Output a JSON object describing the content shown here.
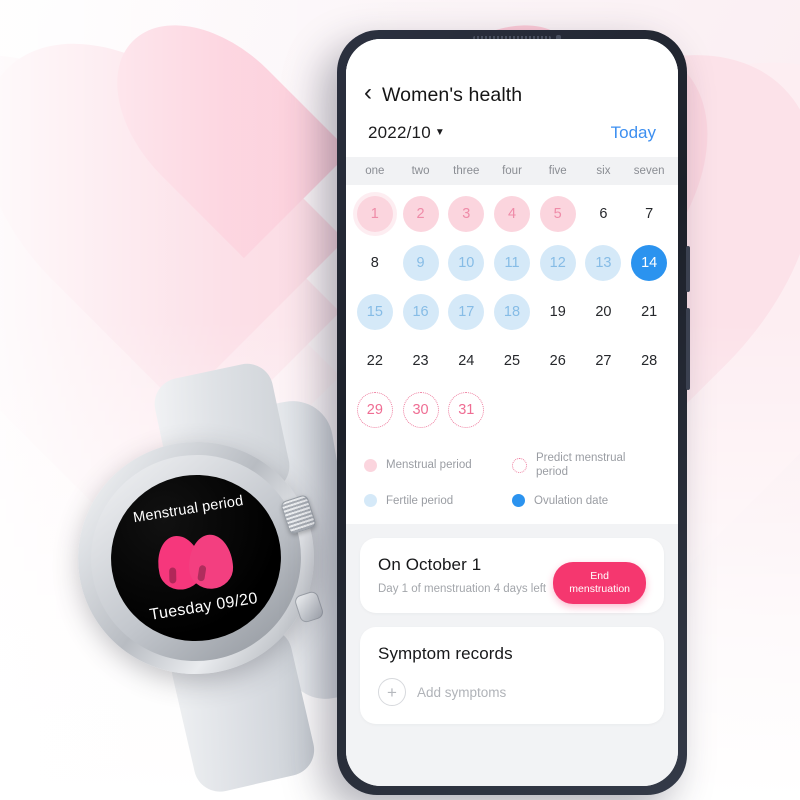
{
  "background": {
    "theme_color": "#fbd6e0",
    "shape": "heart"
  },
  "watch": {
    "face_title": "Menstrual period",
    "face_date": "Tuesday 09/20",
    "icon": "blood-drops-icon",
    "accent_color": "#f6377c"
  },
  "phone": {
    "app": {
      "nav": {
        "back_icon": "chevron-left-icon",
        "title": "Women's health"
      },
      "month_bar": {
        "month": "2022/10",
        "caret_icon": "chevron-down-icon",
        "today_label": "Today",
        "today_color": "#3d8ff0"
      },
      "weekdays": [
        "one",
        "two",
        "three",
        "four",
        "five",
        "six",
        "seven"
      ],
      "calendar": {
        "leading_blanks": 0,
        "days": [
          {
            "n": "1",
            "state": "period-today"
          },
          {
            "n": "2",
            "state": "period"
          },
          {
            "n": "3",
            "state": "period"
          },
          {
            "n": "4",
            "state": "period"
          },
          {
            "n": "5",
            "state": "period"
          },
          {
            "n": "6",
            "state": "normal"
          },
          {
            "n": "7",
            "state": "normal"
          },
          {
            "n": "8",
            "state": "normal"
          },
          {
            "n": "9",
            "state": "fertile"
          },
          {
            "n": "10",
            "state": "fertile"
          },
          {
            "n": "11",
            "state": "fertile"
          },
          {
            "n": "12",
            "state": "fertile"
          },
          {
            "n": "13",
            "state": "fertile"
          },
          {
            "n": "14",
            "state": "ovulation"
          },
          {
            "n": "15",
            "state": "fertile"
          },
          {
            "n": "16",
            "state": "fertile"
          },
          {
            "n": "17",
            "state": "fertile"
          },
          {
            "n": "18",
            "state": "fertile"
          },
          {
            "n": "19",
            "state": "normal"
          },
          {
            "n": "20",
            "state": "normal"
          },
          {
            "n": "21",
            "state": "normal"
          },
          {
            "n": "22",
            "state": "normal"
          },
          {
            "n": "23",
            "state": "normal"
          },
          {
            "n": "24",
            "state": "normal"
          },
          {
            "n": "25",
            "state": "normal"
          },
          {
            "n": "26",
            "state": "normal"
          },
          {
            "n": "27",
            "state": "normal"
          },
          {
            "n": "28",
            "state": "normal"
          },
          {
            "n": "29",
            "state": "predict"
          },
          {
            "n": "30",
            "state": "predict"
          },
          {
            "n": "31",
            "state": "predict"
          }
        ]
      },
      "legend": [
        {
          "label": "Menstrual period",
          "swatch": "pink",
          "color": "#fbd5de"
        },
        {
          "label": "Predict menstrual period",
          "swatch": "dotted",
          "color": "#ef7d9f"
        },
        {
          "label": "Fertile period",
          "swatch": "lblue",
          "color": "#d5e9f8"
        },
        {
          "label": "Ovulation date",
          "swatch": "blue",
          "color": "#2b93ef"
        }
      ],
      "status_card": {
        "title": "On October 1",
        "subtitle": "Day 1 of menstruation 4 days left",
        "button_line1": "End",
        "button_line2": "menstruation",
        "button_color": "#f5376f"
      },
      "symptom_card": {
        "title": "Symptom records",
        "add_icon": "plus-circle-icon",
        "add_label": "Add symptoms"
      }
    }
  }
}
